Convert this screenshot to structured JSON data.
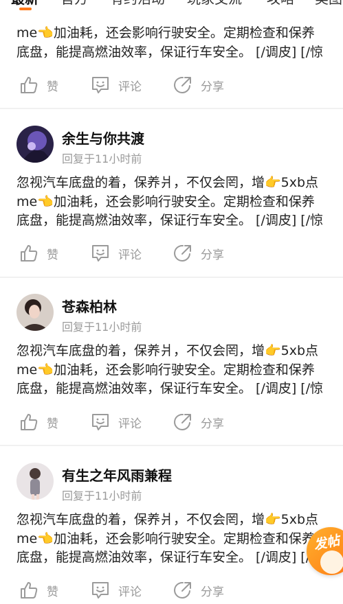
{
  "tabs": [
    "最新",
    "官方",
    "有约活动",
    "玩家交流",
    "攻略",
    "美图"
  ],
  "post_text": [
    "忽视汽车底盘的着，保养爿，不仅会罔，增👉5xb点",
    "me👈加油耗，还会影响行驶安全。定期检查和保养",
    "底盘，能提高燃油效率，保证行车安全。 [/调皮] [/惊"
  ],
  "actions": {
    "like": "赞",
    "comment": "评论",
    "share": "分享"
  },
  "posts": [
    {
      "user": "余生与你共渡",
      "time": "回复于11小时前"
    },
    {
      "user": "苍森柏林",
      "time": "回复于11小时前"
    },
    {
      "user": "有生之年风雨兼程",
      "time": "回复于11小时前"
    }
  ],
  "fab": {
    "label": "发帖"
  },
  "colors": {
    "accent": "#ff7a1a",
    "icon_gray": "#9a9a9a",
    "divider": "#f1f1f1"
  }
}
